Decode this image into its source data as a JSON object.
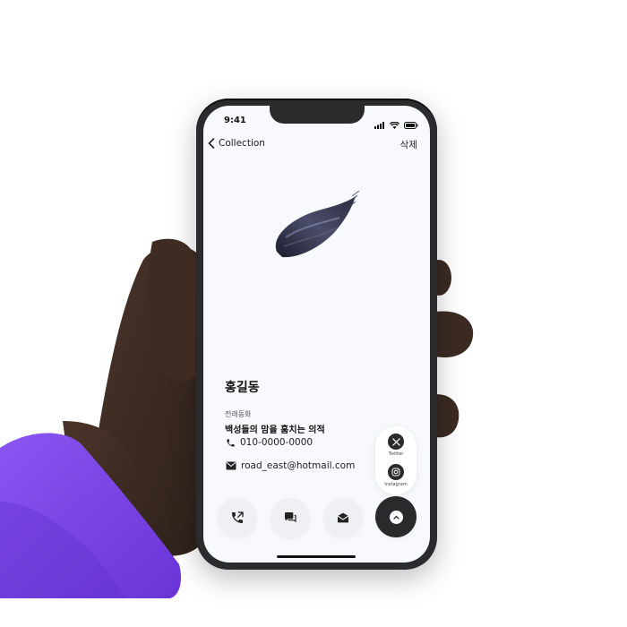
{
  "status": {
    "time": "9:41"
  },
  "nav": {
    "back_label": "Collection",
    "delete_label": "삭제"
  },
  "profile": {
    "name": "홍길동",
    "subtitle": "전래동화",
    "tagline": "백성들의 맘을 훔치는 의적"
  },
  "contacts": {
    "phone": "010-0000-0000",
    "email": "road_east@hotmail.com"
  },
  "social": [
    {
      "label": "Twitter",
      "icon": "x-logo-icon"
    },
    {
      "label": "Instagram",
      "icon": "instagram-icon"
    }
  ],
  "actions": [
    "call-icon",
    "chat-icon",
    "mail-icon",
    "chevron-up-icon"
  ],
  "colors": {
    "sleeve": "#7b44ea",
    "skin": "#3b2a22",
    "phone_frame": "#2b2b2d",
    "screen_bg": "#f8f9fc",
    "action_button": "#eef0f3",
    "primary_action": "#2a2a2c"
  }
}
